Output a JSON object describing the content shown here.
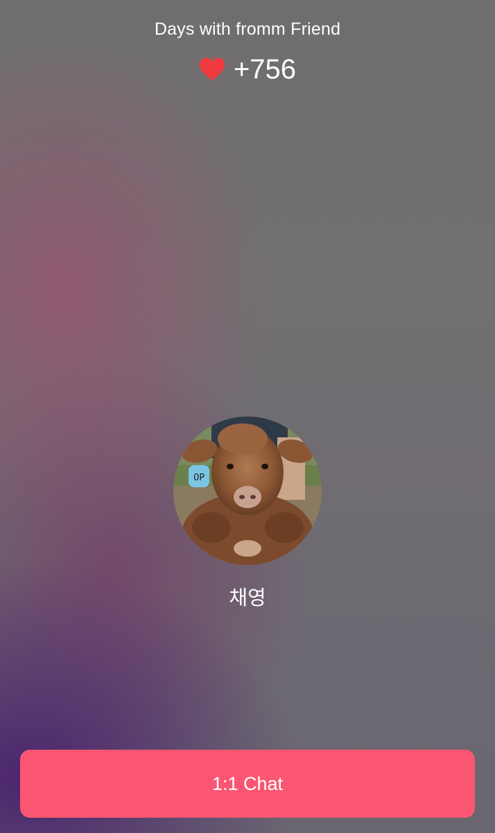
{
  "header": {
    "caption": "Days with fromm Friend",
    "count": "+756",
    "heart_icon": "heart-icon",
    "heart_color": "#ef3b3f"
  },
  "friend": {
    "name": "채영",
    "avatar_icon": "avatar-photo-highland-calf"
  },
  "actions": {
    "chat_label": "1:1 Chat",
    "chat_color": "#fa5672"
  }
}
